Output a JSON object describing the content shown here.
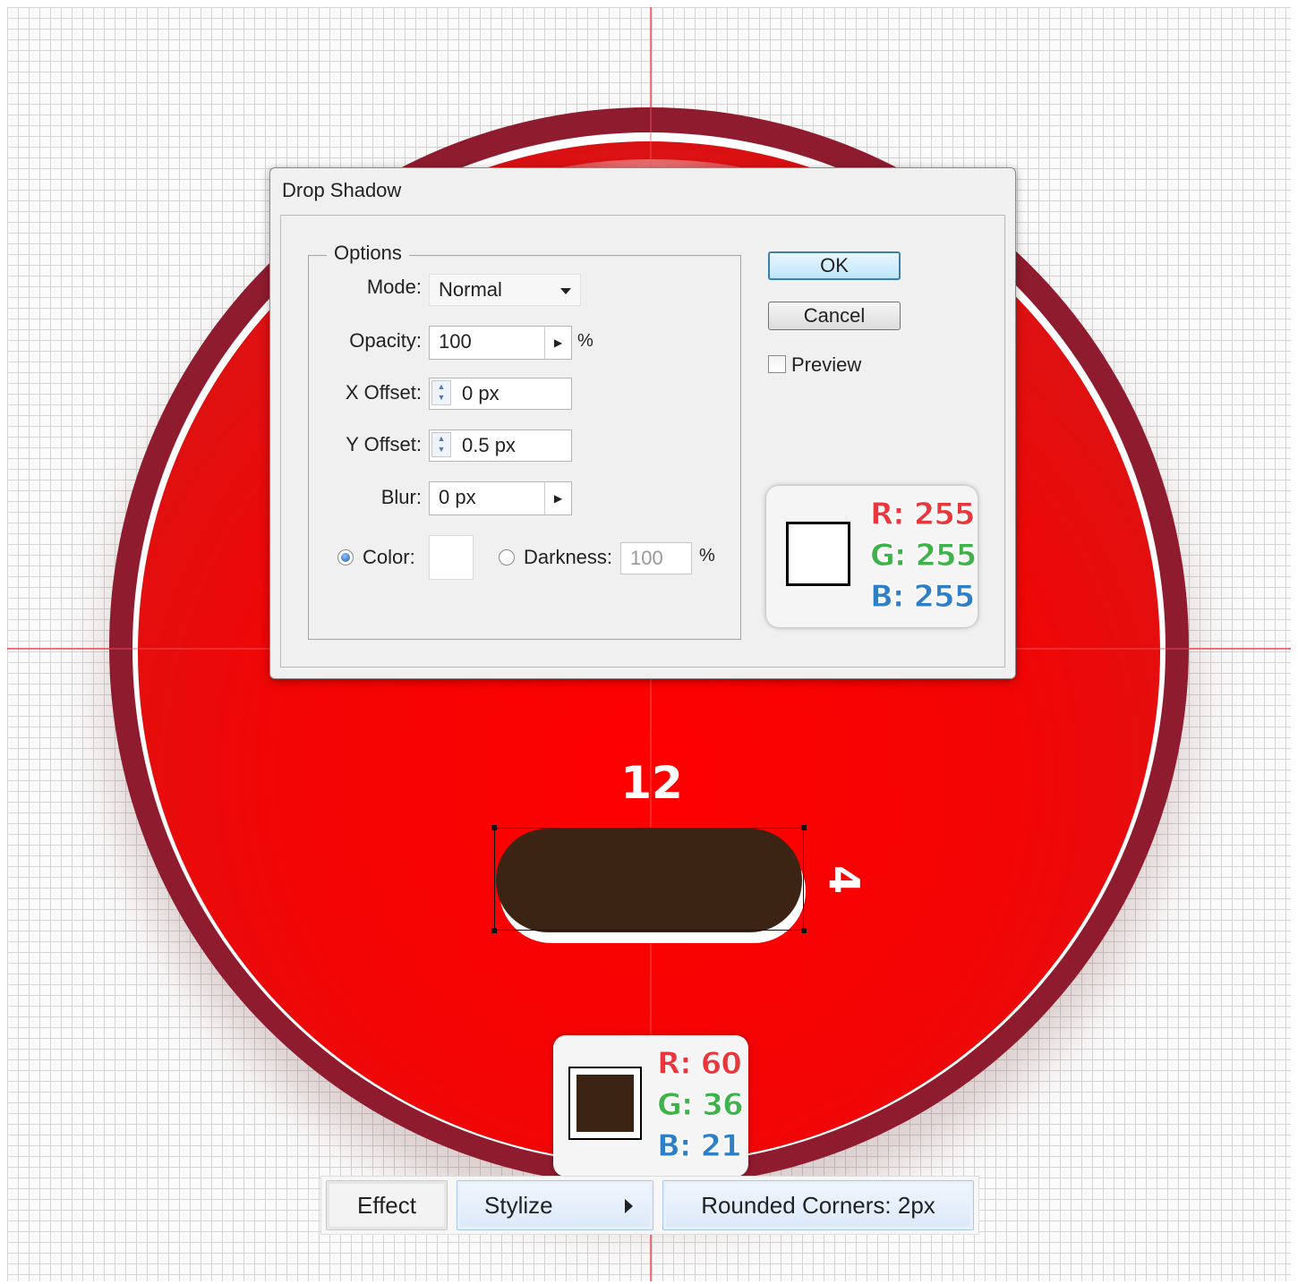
{
  "dialog": {
    "title": "Drop Shadow",
    "options_label": "Options",
    "mode": {
      "label": "Mode:",
      "value": "Normal"
    },
    "opacity": {
      "label": "Opacity:",
      "value": "100",
      "unit": "%"
    },
    "x_offset": {
      "label": "X Offset:",
      "value": "0 px"
    },
    "y_offset": {
      "label": "Y Offset:",
      "value": "0.5 px"
    },
    "blur": {
      "label": "Blur:",
      "value": "0 px"
    },
    "color": {
      "label": "Color:",
      "selected": true,
      "swatch": "#ffffff"
    },
    "darkness": {
      "label": "Darkness:",
      "value": "100",
      "unit": "%",
      "selected": false
    },
    "ok_label": "OK",
    "cancel_label": "Cancel",
    "preview_label": "Preview",
    "preview_checked": false
  },
  "shadow_color_card": {
    "swatch": "#ffffff",
    "r": "R: 255",
    "g": "G: 255",
    "b": "B: 255"
  },
  "fill_color_card": {
    "swatch": "#3c2415",
    "r": "R: 60",
    "g": "G: 36",
    "b": "B: 21"
  },
  "artwork": {
    "width_label": "12",
    "height_label": "4",
    "pill_color": "#3c2415",
    "button_color": "#ff0000",
    "ring_color": "#8f1b2e"
  },
  "menu_path": {
    "effect": "Effect",
    "stylize": "Stylize",
    "rounded": "Rounded Corners: 2px"
  }
}
